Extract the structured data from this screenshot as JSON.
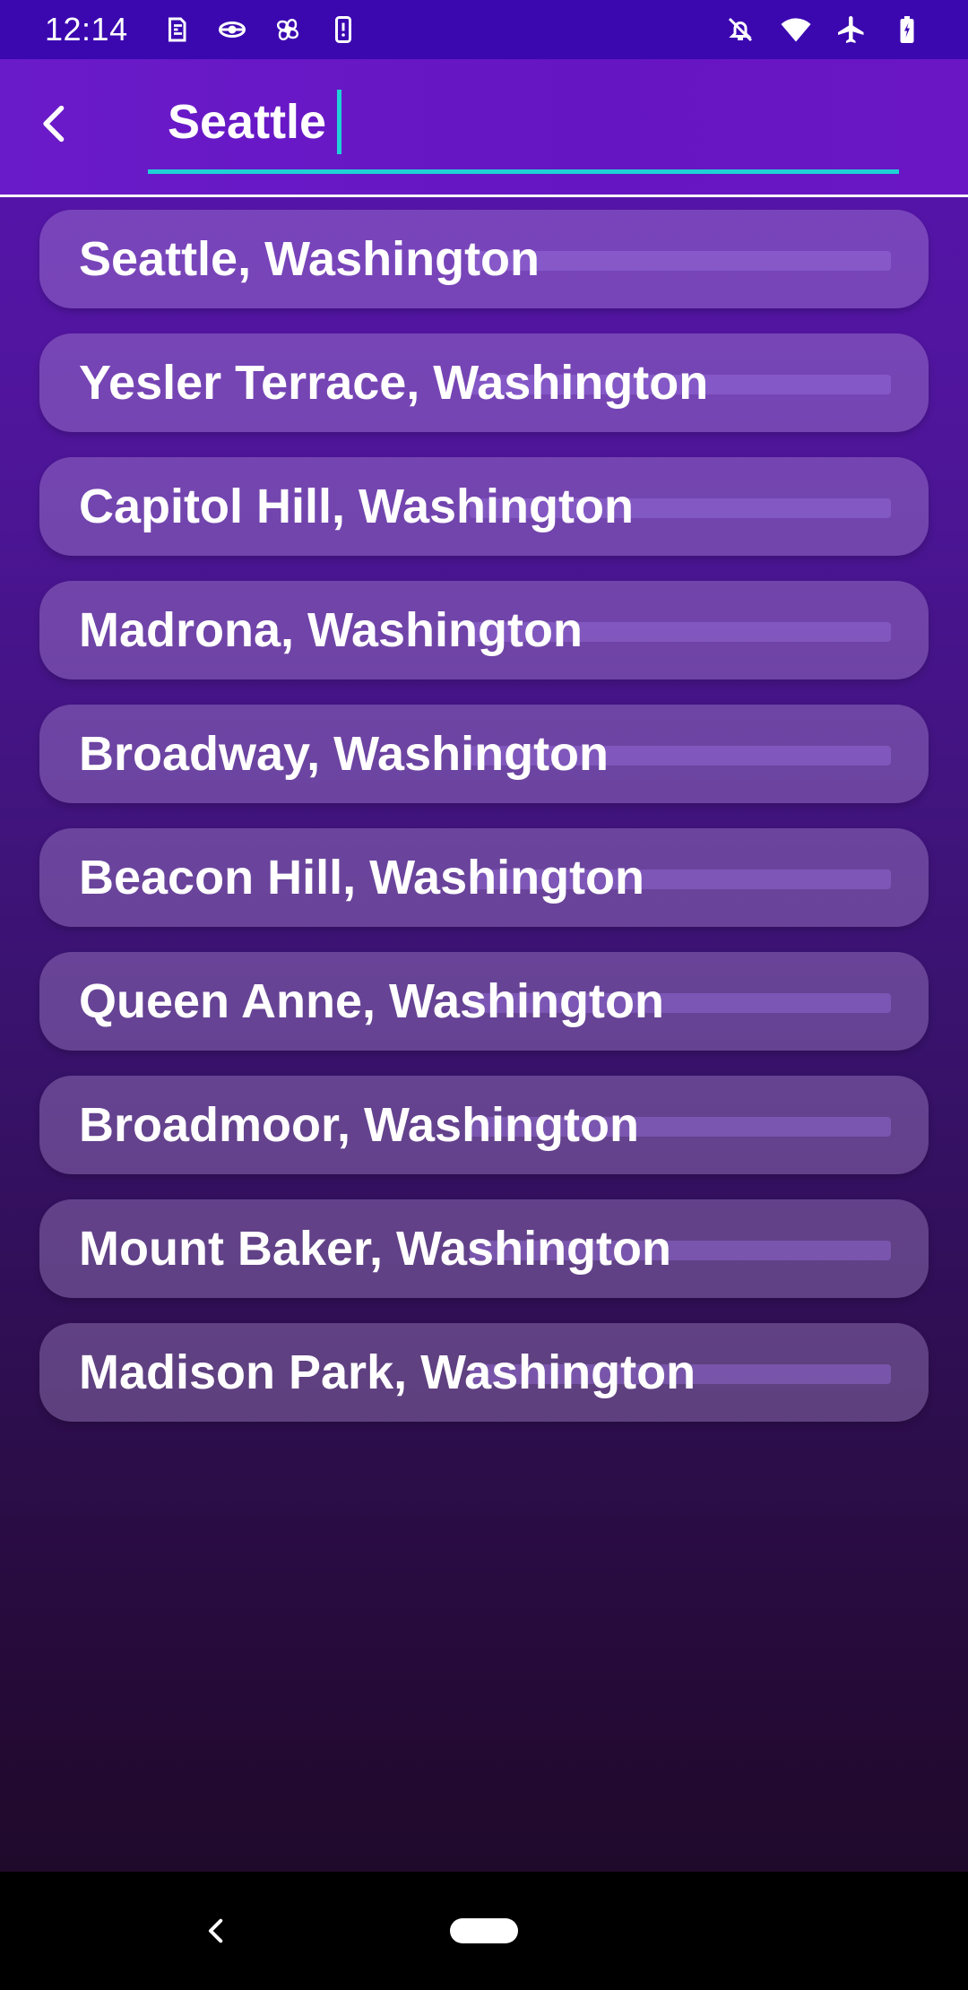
{
  "status_bar": {
    "time": "12:14",
    "left_icons": [
      "sim-icon",
      "satellite-icon",
      "fan-icon",
      "phone-icon"
    ],
    "right_icons": [
      "notifications-off-icon",
      "wifi-icon",
      "airplane-icon",
      "battery-icon"
    ]
  },
  "search": {
    "value": "Seattle",
    "accent_color": "#1fd1d6"
  },
  "results": [
    "Seattle, Washington",
    "Yesler Terrace, Washington",
    "Capitol Hill, Washington",
    "Madrona, Washington",
    "Broadway, Washington",
    "Beacon Hill, Washington",
    "Queen Anne, Washington",
    "Broadmoor, Washington",
    "Mount Baker, Washington",
    "Madison Park, Washington"
  ],
  "colors": {
    "status_bar_bg": "#3b08b0",
    "app_bar_bg": "#6a1bc9",
    "nav_bar_bg": "#000000"
  }
}
